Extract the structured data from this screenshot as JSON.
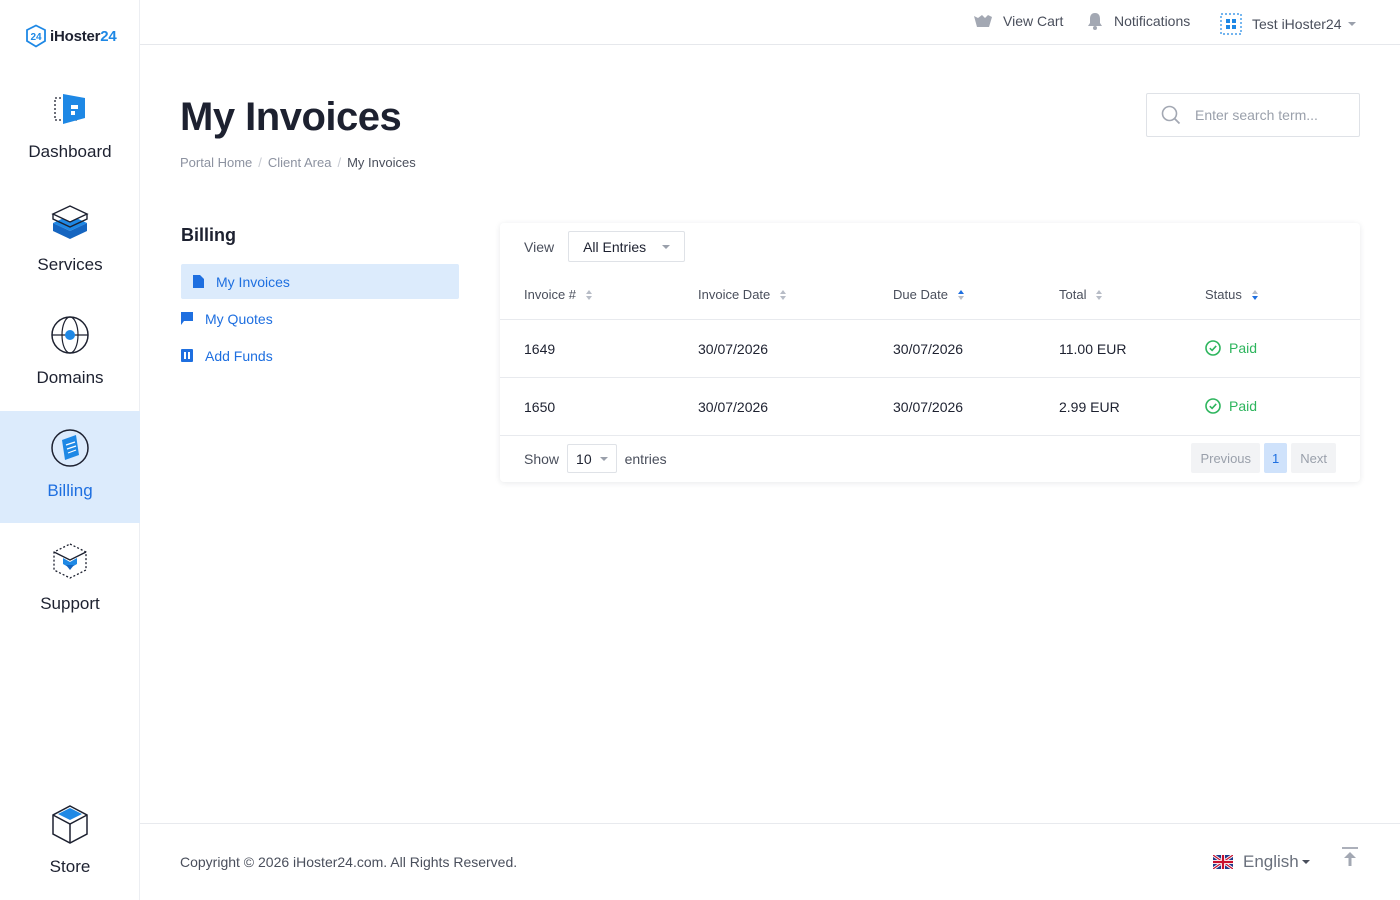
{
  "brand": {
    "name_prefix": "iHoster",
    "name_suffix": "24",
    "accent_color": "#1e88e5"
  },
  "sidebar": {
    "items": [
      {
        "label": "Dashboard",
        "icon": "dashboard-icon",
        "active": false
      },
      {
        "label": "Services",
        "icon": "services-icon",
        "active": false
      },
      {
        "label": "Domains",
        "icon": "globe-icon",
        "active": false
      },
      {
        "label": "Billing",
        "icon": "billing-icon",
        "active": true
      },
      {
        "label": "Support",
        "icon": "support-icon",
        "active": false
      },
      {
        "label": "Store",
        "icon": "store-cube-icon",
        "active": false
      }
    ]
  },
  "topbar": {
    "cart_label": "View Cart",
    "notifications_label": "Notifications",
    "user_label": "Test iHoster24"
  },
  "header": {
    "title": "My Invoices",
    "breadcrumb": [
      "Portal Home",
      "Client Area",
      "My Invoices"
    ],
    "search_placeholder": "Enter search term..."
  },
  "billing_menu": {
    "title": "Billing",
    "items": [
      {
        "label": "My Invoices",
        "icon": "document-icon",
        "active": true
      },
      {
        "label": "My Quotes",
        "icon": "flag-icon",
        "active": false
      },
      {
        "label": "Add Funds",
        "icon": "add-funds-icon",
        "active": false
      }
    ]
  },
  "table": {
    "view_label": "View",
    "view_selected": "All Entries",
    "columns": [
      "Invoice #",
      "Invoice Date",
      "Due Date",
      "Total",
      "Status"
    ],
    "rows": [
      {
        "invoice": "1649",
        "invoice_date": "30/07/2026",
        "due_date": "30/07/2026",
        "total": "11.00 EUR",
        "status": "Paid"
      },
      {
        "invoice": "1650",
        "invoice_date": "30/07/2026",
        "due_date": "30/07/2026",
        "total": "2.99 EUR",
        "status": "Paid"
      }
    ],
    "show_label": "Show",
    "page_size": "10",
    "entries_label": "entries",
    "pagination": {
      "previous": "Previous",
      "current": "1",
      "next": "Next"
    },
    "status_color": "#2db55d"
  },
  "footer": {
    "copyright": "Copyright © 2026 iHoster24.com. All Rights Reserved.",
    "language": "English"
  }
}
